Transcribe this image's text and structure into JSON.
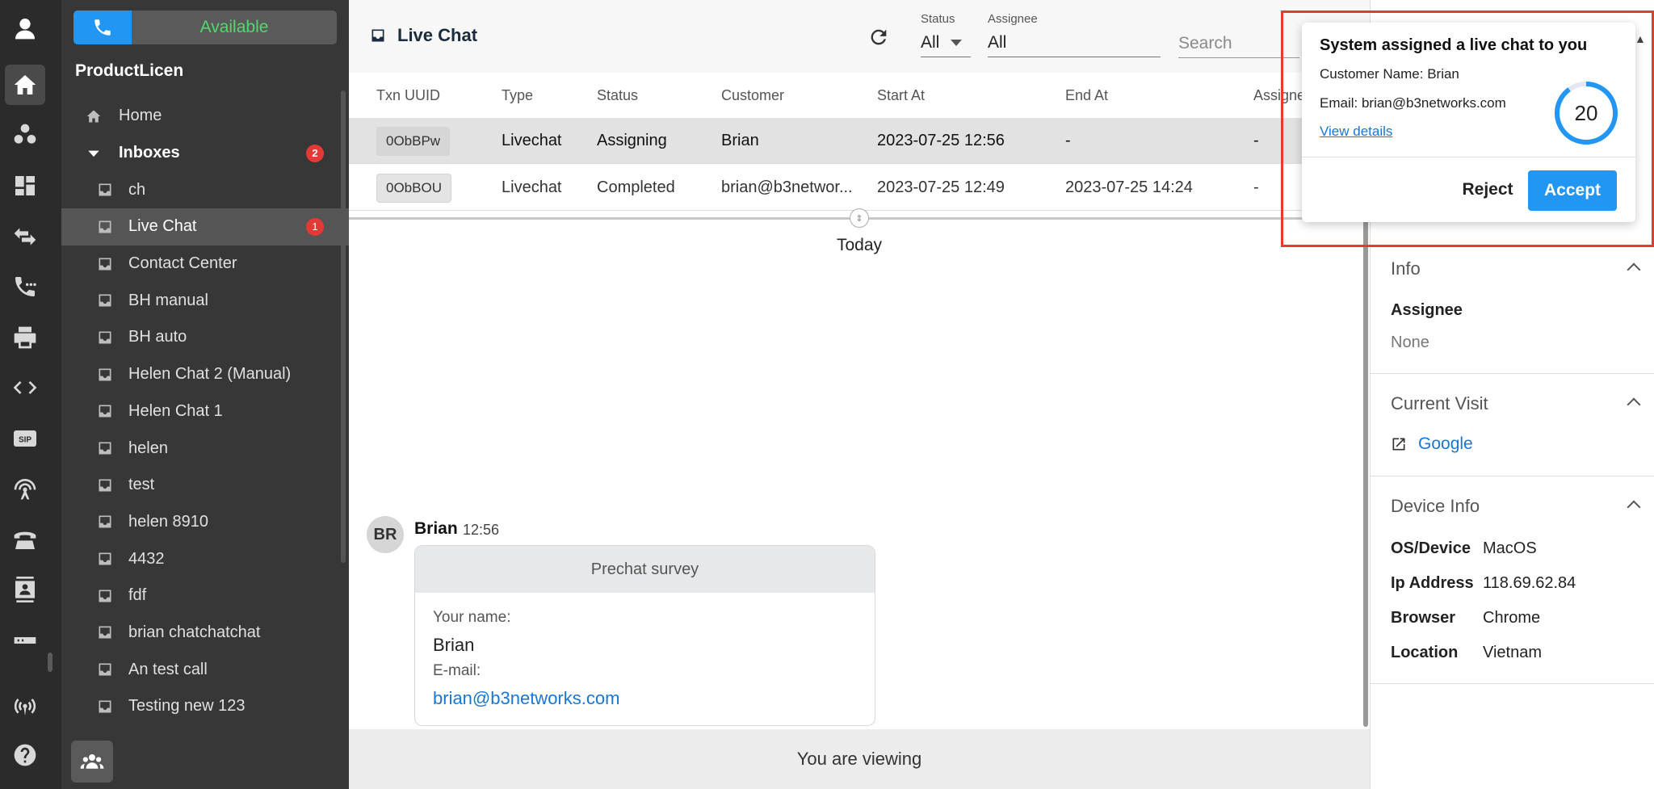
{
  "rail": {
    "icons": [
      "user-icon",
      "home-icon",
      "people-icon",
      "dashboard-icon",
      "transfer-icon",
      "call-log-icon",
      "printer-icon",
      "code-icon",
      "sip-icon",
      "broadcast-icon",
      "desk-phone-icon",
      "contacts-icon",
      "device-icon",
      "wireless-icon",
      "help-icon"
    ],
    "sip_text": "SIP"
  },
  "sidebar": {
    "status": "Available",
    "org": "ProductLicen",
    "home": "Home",
    "inboxes_label": "Inboxes",
    "inboxes_badge": "2",
    "items": [
      {
        "label": "ch"
      },
      {
        "label": "Live Chat",
        "badge": "1"
      },
      {
        "label": "Contact Center"
      },
      {
        "label": "BH manual"
      },
      {
        "label": "BH auto"
      },
      {
        "label": "Helen Chat 2 (Manual)"
      },
      {
        "label": "Helen Chat 1"
      },
      {
        "label": "helen"
      },
      {
        "label": "test"
      },
      {
        "label": "helen 8910"
      },
      {
        "label": "4432"
      },
      {
        "label": "fdf"
      },
      {
        "label": "brian chatchatchat"
      },
      {
        "label": "An test call"
      },
      {
        "label": "Testing new 123"
      }
    ]
  },
  "toolbar": {
    "title": "Live Chat",
    "status_label": "Status",
    "status_value": "All",
    "assignee_label": "Assignee",
    "assignee_value": "All",
    "search_placeholder": "Search"
  },
  "table": {
    "columns": [
      "Txn UUID",
      "Type",
      "Status",
      "Customer",
      "Start At",
      "End At",
      "Assignee"
    ],
    "rows": [
      {
        "uuid": "0ObBPw",
        "type": "Livechat",
        "status": "Assigning",
        "customer": "Brian",
        "start": "2023-07-25 12:56",
        "end": "-",
        "assignee": "-"
      },
      {
        "uuid": "0ObBOU",
        "type": "Livechat",
        "status": "Completed",
        "customer": "brian@b3networ...",
        "start": "2023-07-25 12:49",
        "end": "2023-07-25 14:24",
        "assignee": "-"
      }
    ]
  },
  "chat": {
    "day_label": "Today",
    "avatar_initials": "BR",
    "sender": "Brian",
    "time": "12:56",
    "card_title": "Prechat survey",
    "name_label": "Your name:",
    "name_value": "Brian",
    "email_label": "E-mail:",
    "email_value": "brian@b3networks.com",
    "footer": "You are viewing"
  },
  "info": {
    "title": "Info",
    "assignee_label": "Assignee",
    "assignee_value": "None",
    "visit_title": "Current Visit",
    "visit_link": "Google",
    "device_title": "Device Info",
    "device_rows": [
      {
        "label": "OS/Device",
        "value": "MacOS"
      },
      {
        "label": "Ip Address",
        "value": "118.69.62.84"
      },
      {
        "label": "Browser",
        "value": "Chrome"
      },
      {
        "label": "Location",
        "value": "Vietnam"
      }
    ]
  },
  "popup": {
    "title": "System assigned a live chat to you",
    "customer": "Customer Name: Brian",
    "email": "Email: brian@b3networks.com",
    "link": "View details",
    "countdown": "20",
    "countdown_fraction": 0.9,
    "reject": "Reject",
    "accept": "Accept"
  }
}
